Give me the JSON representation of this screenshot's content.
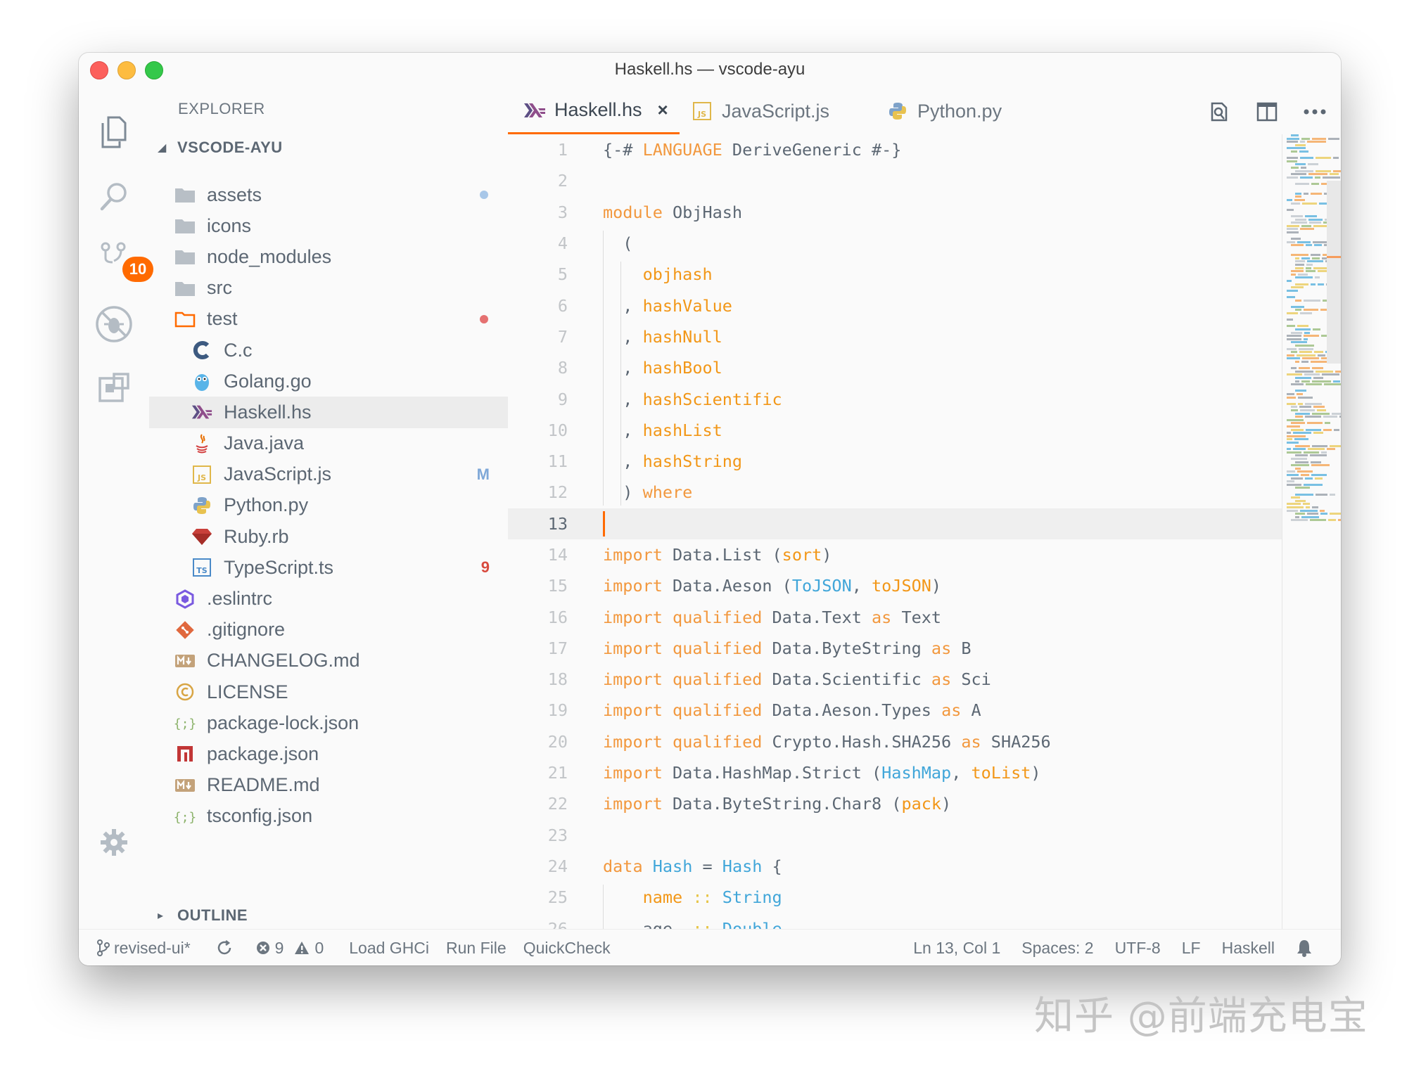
{
  "window": {
    "title": "Haskell.hs — vscode-ayu"
  },
  "activity_bar": {
    "scm_badge": "10"
  },
  "sidebar": {
    "title": "EXPLORER",
    "project": "VSCODE-AYU",
    "outline": "OUTLINE",
    "items": [
      {
        "label": "assets",
        "icon": "folder-icon",
        "depth": 0,
        "deco": "dot",
        "decoColor": "#a8c7e8"
      },
      {
        "label": "icons",
        "icon": "folder-icon",
        "depth": 0
      },
      {
        "label": "node_modules",
        "icon": "folder-icon",
        "depth": 0
      },
      {
        "label": "src",
        "icon": "folder-icon",
        "depth": 0
      },
      {
        "label": "test",
        "icon": "folder-open-icon",
        "depth": 0,
        "deco": "dot",
        "decoColor": "#e57171"
      },
      {
        "label": "C.c",
        "icon": "c-lang-icon",
        "depth": 1
      },
      {
        "label": "Golang.go",
        "icon": "gopher-icon",
        "depth": 1
      },
      {
        "label": "Haskell.hs",
        "icon": "haskell-icon",
        "depth": 1,
        "selected": true
      },
      {
        "label": "Java.java",
        "icon": "java-icon",
        "depth": 1
      },
      {
        "label": "JavaScript.js",
        "icon": "javascript-icon",
        "depth": 1,
        "deco": "text",
        "decoText": "M",
        "decoColor": "#7fa8d8"
      },
      {
        "label": "Python.py",
        "icon": "python-icon",
        "depth": 1
      },
      {
        "label": "Ruby.rb",
        "icon": "ruby-icon",
        "depth": 1
      },
      {
        "label": "TypeScript.ts",
        "icon": "typescript-icon",
        "depth": 1,
        "deco": "text",
        "decoText": "9",
        "decoColor": "#d84a3e"
      },
      {
        "label": ".eslintrc",
        "icon": "eslint-icon",
        "depth": 0
      },
      {
        "label": ".gitignore",
        "icon": "git-icon",
        "depth": 0
      },
      {
        "label": "CHANGELOG.md",
        "icon": "markdown-icon",
        "depth": 0
      },
      {
        "label": "LICENSE",
        "icon": "license-icon",
        "depth": 0
      },
      {
        "label": "package-lock.json",
        "icon": "json-icon",
        "depth": 0
      },
      {
        "label": "package.json",
        "icon": "npm-icon",
        "depth": 0
      },
      {
        "label": "README.md",
        "icon": "markdown-icon",
        "depth": 0
      },
      {
        "label": "tsconfig.json",
        "icon": "json-icon",
        "depth": 0
      }
    ]
  },
  "tabs": [
    {
      "label": "Haskell.hs",
      "icon": "haskell-icon",
      "active": true,
      "close": "×"
    },
    {
      "label": "JavaScript.js",
      "icon": "javascript-icon"
    },
    {
      "label": "Python.py",
      "icon": "python-icon"
    }
  ],
  "editor": {
    "current_line": 13,
    "lines": [
      [
        [
          "{-# ",
          "p"
        ],
        [
          "LANGUAGE",
          "k"
        ],
        [
          " DeriveGeneric #-}",
          "p"
        ]
      ],
      [],
      [
        [
          "module",
          "k"
        ],
        [
          " ObjHash",
          "p"
        ]
      ],
      [
        [
          "  (",
          "p"
        ]
      ],
      [
        [
          "    ",
          "p"
        ],
        [
          "objhash",
          "f"
        ]
      ],
      [
        [
          "  , ",
          "p"
        ],
        [
          "hashValue",
          "f"
        ]
      ],
      [
        [
          "  , ",
          "p"
        ],
        [
          "hashNull",
          "f"
        ]
      ],
      [
        [
          "  , ",
          "p"
        ],
        [
          "hashBool",
          "f"
        ]
      ],
      [
        [
          "  , ",
          "p"
        ],
        [
          "hashScientific",
          "f"
        ]
      ],
      [
        [
          "  , ",
          "p"
        ],
        [
          "hashList",
          "f"
        ]
      ],
      [
        [
          "  , ",
          "p"
        ],
        [
          "hashString",
          "f"
        ]
      ],
      [
        [
          "  ) ",
          "p"
        ],
        [
          "where",
          "k"
        ]
      ],
      [],
      [
        [
          "import",
          "k"
        ],
        [
          " Data.List (",
          "p"
        ],
        [
          "sort",
          "f"
        ],
        [
          ")",
          "p"
        ]
      ],
      [
        [
          "import",
          "k"
        ],
        [
          " Data.Aeson (",
          "p"
        ],
        [
          "ToJSON",
          "t"
        ],
        [
          ", ",
          "p"
        ],
        [
          "toJSON",
          "f"
        ],
        [
          ")",
          "p"
        ]
      ],
      [
        [
          "import",
          "k"
        ],
        [
          " ",
          "p"
        ],
        [
          "qualified",
          "k"
        ],
        [
          " Data.Text ",
          "p"
        ],
        [
          "as",
          "k"
        ],
        [
          " Text",
          "p"
        ]
      ],
      [
        [
          "import",
          "k"
        ],
        [
          " ",
          "p"
        ],
        [
          "qualified",
          "k"
        ],
        [
          " Data.ByteString ",
          "p"
        ],
        [
          "as",
          "k"
        ],
        [
          " B",
          "p"
        ]
      ],
      [
        [
          "import",
          "k"
        ],
        [
          " ",
          "p"
        ],
        [
          "qualified",
          "k"
        ],
        [
          " Data.Scientific ",
          "p"
        ],
        [
          "as",
          "k"
        ],
        [
          " Sci",
          "p"
        ]
      ],
      [
        [
          "import",
          "k"
        ],
        [
          " ",
          "p"
        ],
        [
          "qualified",
          "k"
        ],
        [
          " Data.Aeson.Types ",
          "p"
        ],
        [
          "as",
          "k"
        ],
        [
          " A",
          "p"
        ]
      ],
      [
        [
          "import",
          "k"
        ],
        [
          " ",
          "p"
        ],
        [
          "qualified",
          "k"
        ],
        [
          " Crypto.Hash.SHA256 ",
          "p"
        ],
        [
          "as",
          "k"
        ],
        [
          " SHA256",
          "p"
        ]
      ],
      [
        [
          "import",
          "k"
        ],
        [
          " Data.HashMap.Strict (",
          "p"
        ],
        [
          "HashMap",
          "t"
        ],
        [
          ", ",
          "p"
        ],
        [
          "toList",
          "f"
        ],
        [
          ")",
          "p"
        ]
      ],
      [
        [
          "import",
          "k"
        ],
        [
          " Data.ByteString.Char8 (",
          "p"
        ],
        [
          "pack",
          "f"
        ],
        [
          ")",
          "p"
        ]
      ],
      [],
      [
        [
          "data",
          "k"
        ],
        [
          " ",
          "p"
        ],
        [
          "Hash",
          "t"
        ],
        [
          " = ",
          "p"
        ],
        [
          "Hash",
          "t"
        ],
        [
          " {",
          "p"
        ]
      ],
      [
        [
          "    ",
          "p"
        ],
        [
          "name",
          "f"
        ],
        [
          " ",
          "p"
        ],
        [
          "::",
          "o"
        ],
        [
          " ",
          "p"
        ],
        [
          "String",
          "t"
        ]
      ],
      [
        [
          "  , age  ",
          "p"
        ],
        [
          "::",
          "o"
        ],
        [
          " ",
          "p"
        ],
        [
          "Double",
          "t"
        ]
      ]
    ]
  },
  "status": {
    "branch": "revised-ui*",
    "errors": "9",
    "warnings": "0",
    "commands": [
      "Load GHCi",
      "Run File",
      "QuickCheck"
    ],
    "position": "Ln 13, Col 1",
    "spaces": "Spaces: 2",
    "encoding": "UTF-8",
    "eol": "LF",
    "language": "Haskell"
  },
  "watermark": "知乎 @前端充电宝",
  "colors": {
    "accent": "#ff6a00",
    "keyword": "#f2983e",
    "type": "#41a6d9",
    "operator": "#e7c547"
  }
}
